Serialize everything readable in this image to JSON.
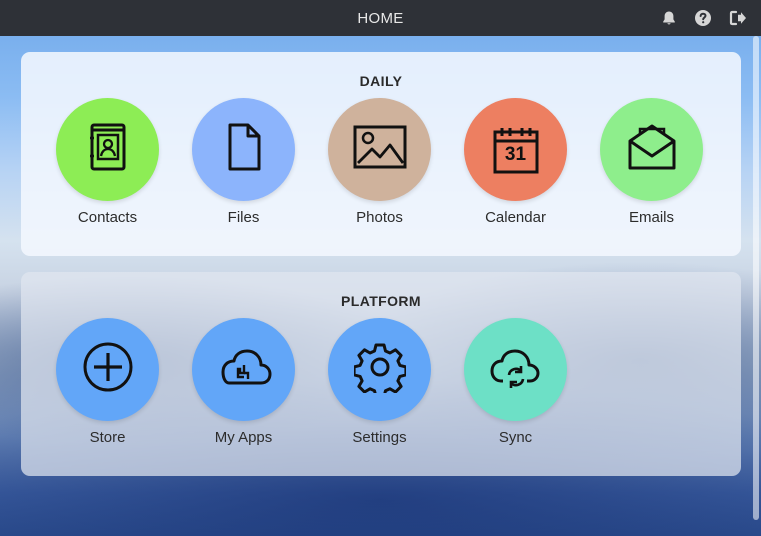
{
  "topbar": {
    "title": "HOME",
    "icons": [
      "bell-icon",
      "help-icon",
      "logout-icon"
    ]
  },
  "sections": [
    {
      "title": "DAILY",
      "apps": [
        {
          "label": "Contacts",
          "icon": "contacts-book-icon",
          "color": "#8ded55"
        },
        {
          "label": "Files",
          "icon": "file-icon",
          "color": "#8cb4fc"
        },
        {
          "label": "Photos",
          "icon": "image-icon",
          "color": "#cfb29c"
        },
        {
          "label": "Calendar",
          "icon": "calendar-icon",
          "color": "#ed7f61",
          "badge": "31"
        },
        {
          "label": "Emails",
          "icon": "envelope-icon",
          "color": "#8eee8c"
        }
      ]
    },
    {
      "title": "PLATFORM",
      "apps": [
        {
          "label": "Store",
          "icon": "plus-circle-icon",
          "color": "#62a6f8"
        },
        {
          "label": "My Apps",
          "icon": "cloud-apps-icon",
          "color": "#62a6f8"
        },
        {
          "label": "Settings",
          "icon": "gear-icon",
          "color": "#62a6f8"
        },
        {
          "label": "Sync",
          "icon": "cloud-sync-icon",
          "color": "#6de0c6"
        }
      ]
    }
  ]
}
